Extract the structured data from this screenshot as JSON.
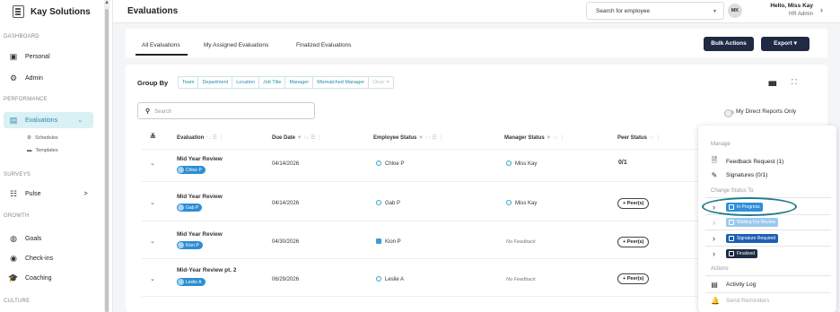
{
  "brand": {
    "name": "Kay Solutions"
  },
  "sidebar": {
    "sections": [
      "DASHBOARD",
      "PERFORMANCE",
      "SURVEYS",
      "GROWTH",
      "CULTURE"
    ],
    "items": [
      {
        "label": "Personal",
        "icon": "id-card-icon"
      },
      {
        "label": "Admin",
        "icon": "admin-gear-icon"
      },
      {
        "label": "Evaluations",
        "icon": "evaluations-icon"
      },
      {
        "label": "Pulse",
        "icon": "pulse-icon"
      },
      {
        "label": "Goals",
        "icon": "goals-icon"
      },
      {
        "label": "Check-ins",
        "icon": "check-ins-icon"
      },
      {
        "label": "Coaching",
        "icon": "coaching-icon"
      }
    ],
    "subitems": [
      {
        "label": "Schedules",
        "icon": "gear-icon"
      },
      {
        "label": "Templates",
        "icon": "template-icon"
      }
    ],
    "evaluations_chevron": "⌄",
    "pulse_chevron": ">"
  },
  "header": {
    "title": "Evaluations",
    "search_placeholder": "Search for employee",
    "avatar_initials": "MK",
    "hello": "Hello, Miss Kay",
    "role": "HR Admin"
  },
  "tabs": [
    "All Evaluations",
    "My Assigned Evaluations",
    "Finalized Evaluations"
  ],
  "actions": {
    "bulk": "Bulk Actions",
    "export": "Export ▾"
  },
  "group_by": {
    "label": "Group By",
    "chips": [
      "Team",
      "Department",
      "Location",
      "Job Title",
      "Manager",
      "Mismatched Manager",
      "Clear ✕"
    ]
  },
  "search": {
    "placeholder": "Search"
  },
  "my_direct": "My Direct Reports Only",
  "columns": [
    "Evaluation",
    "Due Date",
    "Employee Status",
    "Manager Status",
    "Peer Status"
  ],
  "rows": [
    {
      "title": "Mid Year Review",
      "tag": "Chloe P",
      "due": "04/14/2026",
      "employee": "Chloe P",
      "emp_icon": "circle",
      "manager": "Miss Kay",
      "manager_nofb": false,
      "peer": "0/1",
      "peer_btn": false
    },
    {
      "title": "Mid Year Review",
      "tag": "Gab P",
      "due": "04/14/2026",
      "employee": "Gab P",
      "emp_icon": "circle",
      "manager": "Miss Kay",
      "manager_nofb": false,
      "peer": "+ Peer(s)",
      "peer_btn": true
    },
    {
      "title": "Mid Year Review",
      "tag": "Kion P",
      "due": "04/30/2026",
      "employee": "Kion P",
      "emp_icon": "square",
      "manager": "No Feedback",
      "manager_nofb": true,
      "peer": "+ Peer(s)",
      "peer_btn": true
    },
    {
      "title": "Mid-Year Review pt. 2",
      "tag": "Leslie A",
      "due": "06/29/2026",
      "employee": "Leslie A",
      "emp_icon": "circle",
      "manager": "No Feedback",
      "manager_nofb": true,
      "peer": "+ Peer(s)",
      "peer_btn": true
    }
  ],
  "menu": {
    "manage_head": "Manage",
    "feedback": "Feedback Request (1)",
    "signatures": "Signatures (0/1)",
    "change_head": "Change Status To",
    "statuses": [
      {
        "label": "In Progress",
        "color": "#2f8fd8"
      },
      {
        "label": "Waiting For Review",
        "color": "#9cc9ee"
      },
      {
        "label": "Signature Required",
        "color": "#1f5fb5"
      },
      {
        "label": "Finalized",
        "color": "#1f2a44"
      }
    ],
    "actions_head": "Actions",
    "activity": "Activity Log",
    "reminders": "Send Reminders"
  }
}
